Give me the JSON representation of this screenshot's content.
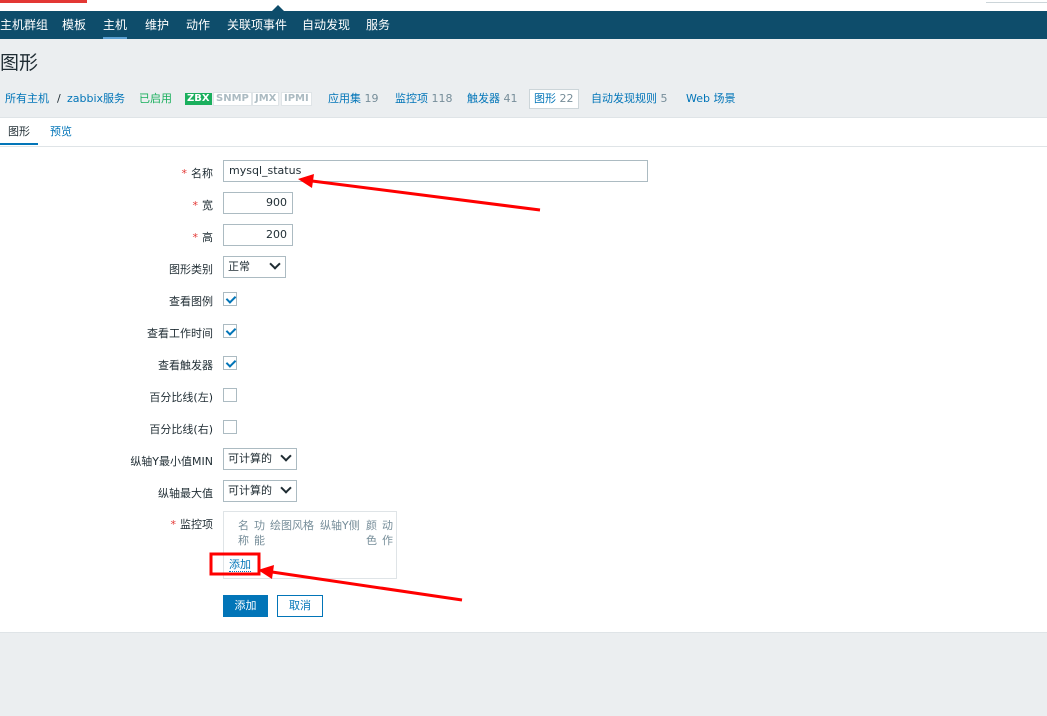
{
  "nav": {
    "items": [
      "主机群组",
      "模板",
      "主机",
      "维护",
      "动作",
      "关联项事件",
      "自动发现",
      "服务"
    ],
    "active": "主机"
  },
  "page": {
    "title": "图形"
  },
  "breadcrumb": {
    "all_hosts": "所有主机",
    "separator": "/",
    "host": "zabbix服务",
    "status": "已启用",
    "badges": {
      "zbx": "ZBX",
      "snmp": "SNMP",
      "jmx": "JMX",
      "ipmi": "IPMI"
    },
    "links": [
      {
        "label": "应用集",
        "count": "19"
      },
      {
        "label": "监控项",
        "count": "118"
      },
      {
        "label": "触发器",
        "count": "41"
      },
      {
        "label": "图形",
        "count": "22"
      },
      {
        "label": "自动发现规则",
        "count": "5"
      },
      {
        "label": "Web 场景",
        "count": ""
      }
    ]
  },
  "tabs": [
    "图形",
    "预览"
  ],
  "form": {
    "name_label": "名称",
    "name_value": "mysql_status",
    "width_label": "宽",
    "width_value": "900",
    "height_label": "高",
    "height_value": "200",
    "type_label": "图形类别",
    "type_value": "正常",
    "legend_label": "查看图例",
    "legend_checked": true,
    "worktime_label": "查看工作时间",
    "worktime_checked": true,
    "triggers_label": "查看触发器",
    "triggers_checked": true,
    "percent_left_label": "百分比线(左)",
    "percent_left_checked": false,
    "percent_right_label": "百分比线(右)",
    "percent_right_checked": false,
    "ymin_label": "纵轴Y最小值MIN",
    "ymin_value": "可计算的",
    "ymax_label": "纵轴最大值",
    "ymax_value": "可计算的",
    "items_label": "监控项",
    "items_columns": [
      "名称",
      "功能",
      "绘图风格",
      "纵轴Y侧",
      "颜色",
      "动作"
    ],
    "items_add": "添加",
    "required_mark": "*",
    "submit": "添加",
    "cancel": "取消"
  },
  "colors": {
    "nav_bg": "#0e4d6b",
    "link": "#0275b8",
    "enabled": "#1aaf5d",
    "annotation": "#ff0000"
  }
}
